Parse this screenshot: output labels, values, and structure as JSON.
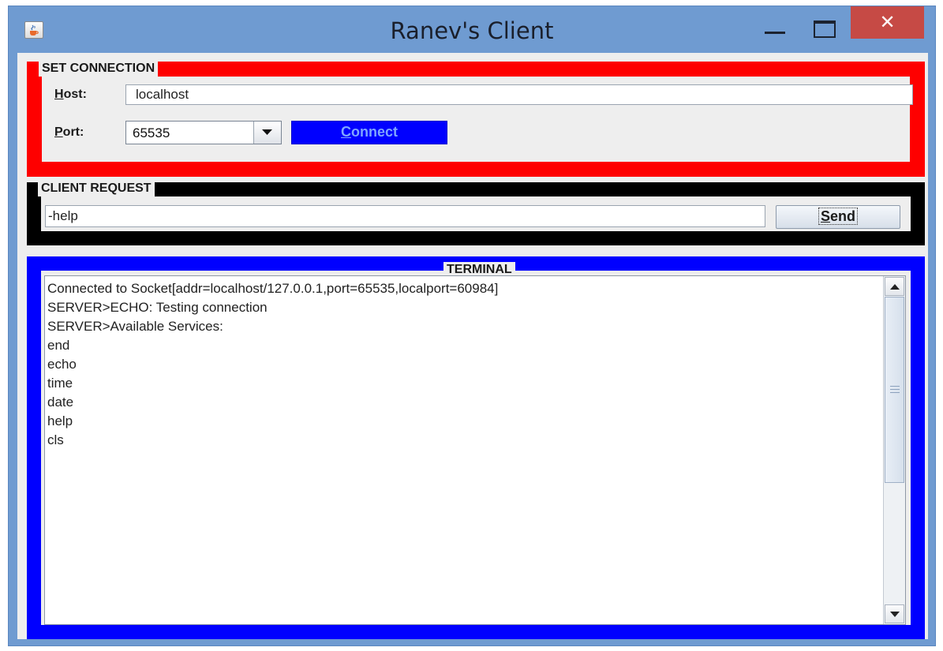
{
  "window": {
    "title": "Ranev's Client",
    "close_glyph": "✕",
    "icons": {
      "app": "java-cup-icon",
      "minimize": "minimize-icon",
      "maximize": "maximize-icon",
      "close": "close-icon"
    }
  },
  "connection": {
    "legend": "SET CONNECTION",
    "host_label_mnemonic": "H",
    "host_label_rest": "ost:",
    "host_value": "localhost",
    "port_label_mnemonic": "P",
    "port_label_rest": "ort:",
    "port_value": "65535",
    "connect_mnemonic": "C",
    "connect_rest": "onnect",
    "border_color": "#fe0000",
    "connect_color": "#0000ff"
  },
  "request": {
    "legend": "CLIENT REQUEST",
    "input_value": "-help",
    "send_mnemonic": "S",
    "send_rest": "end",
    "border_color": "#000000"
  },
  "terminal": {
    "legend": "TERMINAL",
    "border_color": "#0000ff",
    "lines": [
      "Connected to Socket[addr=localhost/127.0.0.1,port=65535,localport=60984]",
      "SERVER>ECHO: Testing connection",
      "SERVER>Available Services:",
      "end",
      "echo",
      "time",
      "date",
      "help",
      "cls"
    ]
  }
}
